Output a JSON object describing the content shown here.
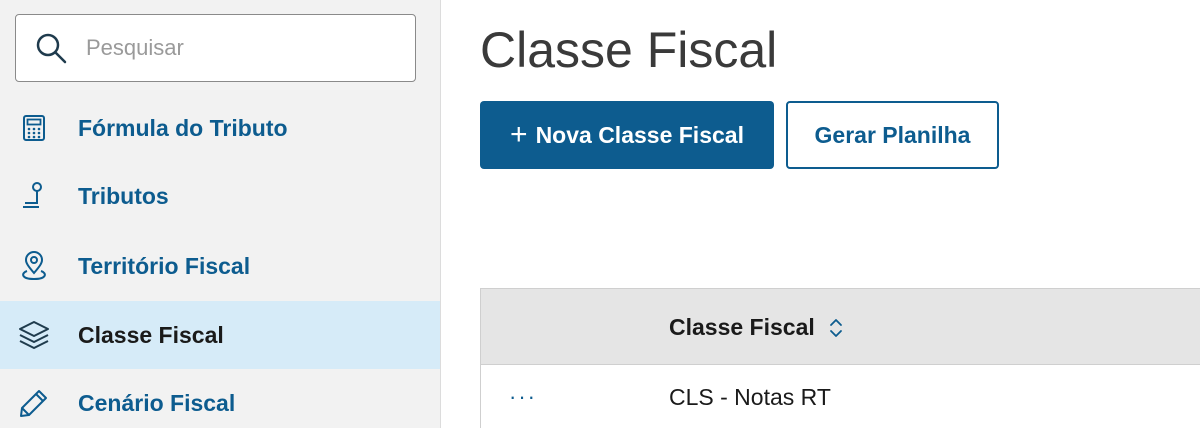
{
  "search": {
    "placeholder": "Pesquisar"
  },
  "sidebar": {
    "items": [
      {
        "label": "Fórmula do Tributo",
        "icon": "calculator-icon",
        "active": false
      },
      {
        "label": "Tributos",
        "icon": "tax-pin-icon",
        "active": false
      },
      {
        "label": "Território Fiscal",
        "icon": "map-pin-icon",
        "active": false
      },
      {
        "label": "Classe Fiscal",
        "icon": "layers-icon",
        "active": true
      },
      {
        "label": "Cenário Fiscal",
        "icon": "pencil-icon",
        "active": false
      }
    ]
  },
  "main": {
    "title": "Classe Fiscal",
    "new_button_label": "Nova Classe Fiscal",
    "new_button_icon": "plus",
    "spreadsheet_button_label": "Gerar Planilha"
  },
  "table": {
    "columns": [
      "Classe Fiscal"
    ],
    "rows": [
      {
        "menu": "···",
        "classe_fiscal": "CLS - Notas RT"
      }
    ]
  },
  "colors": {
    "brand": "#0d5c8f",
    "active_bg": "#d6ebf8",
    "sidebar_bg": "#f2f2f2",
    "table_header_bg": "#e5e5e5"
  }
}
